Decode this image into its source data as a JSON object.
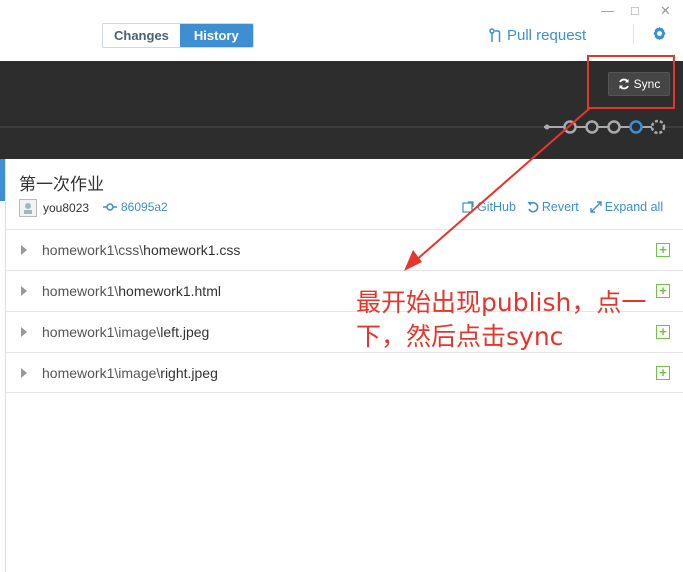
{
  "window": {
    "minimize_glyph": "—",
    "maximize_glyph": "□",
    "close_glyph": "✕"
  },
  "tabs": {
    "changes_label": "Changes",
    "history_label": "History",
    "active": "History"
  },
  "toolbar": {
    "pull_request_label": "Pull request",
    "pull_request_icon": "git-pull-request-icon",
    "settings_icon": "gear-icon"
  },
  "sync": {
    "label": "Sync",
    "icon": "sync-icon"
  },
  "commit": {
    "title": "第一次作业",
    "author": "you8023",
    "sha": "86095a2",
    "actions": {
      "github": "GitHub",
      "revert": "Revert",
      "expand_all": "Expand all"
    }
  },
  "files": [
    {
      "dir": "homework1\\css\\",
      "name": "homework1.css"
    },
    {
      "dir": "homework1\\",
      "name": "homework1.html"
    },
    {
      "dir": "homework1\\image\\",
      "name": "left.jpeg"
    },
    {
      "dir": "homework1\\image\\",
      "name": "right.jpeg"
    }
  ],
  "annotation": {
    "line1": "最开始出现publish，点一",
    "line2": "下，然后点击sync",
    "color": "#e8352b"
  },
  "colors": {
    "accent": "#3d8fd1",
    "dark_band": "#2d2d2d",
    "added": "#6cc644"
  }
}
